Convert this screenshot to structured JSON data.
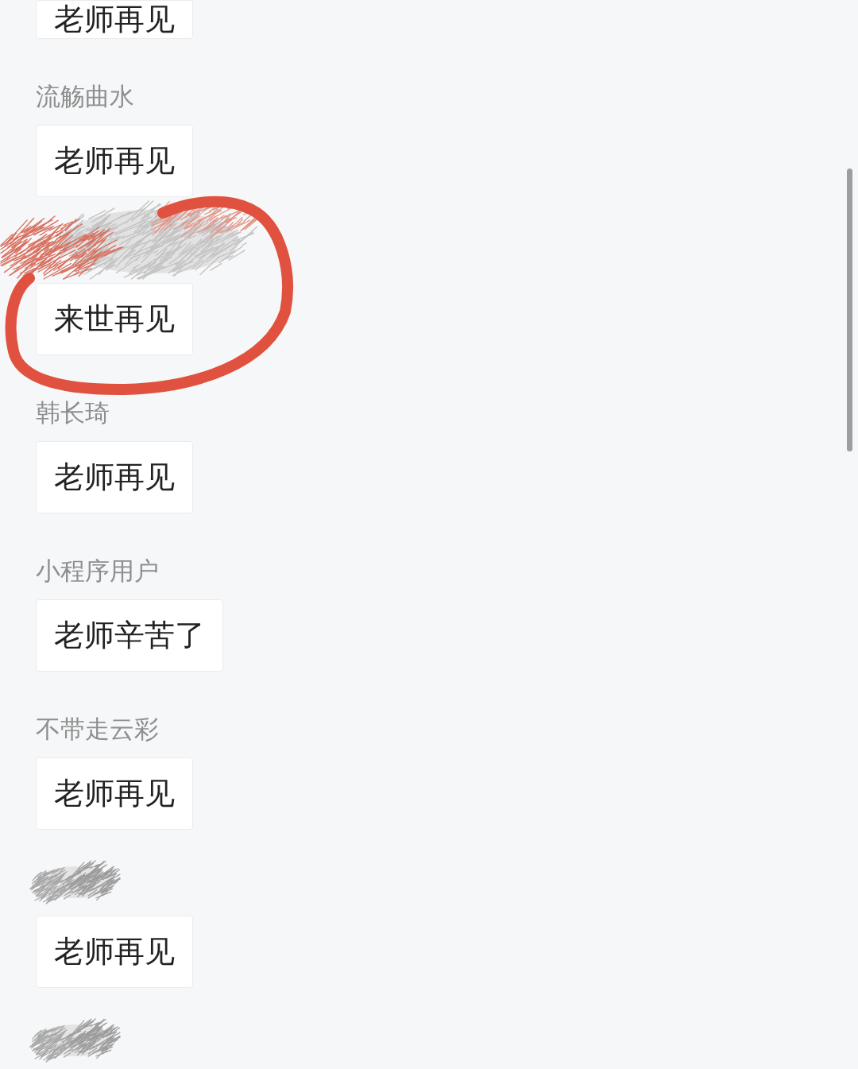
{
  "messages": [
    {
      "text": "老师再见",
      "redacted": false,
      "circled": false
    },
    {
      "sender": "流觞曲水",
      "text": "老师再见",
      "redacted": false,
      "circled": false
    },
    {
      "text": "来世再见",
      "redacted": true,
      "circled": true
    },
    {
      "sender": "韩长琦",
      "text": "老师再见",
      "redacted": false,
      "circled": false
    },
    {
      "sender": "小程序用户",
      "text": "老师辛苦了",
      "redacted": false,
      "circled": false
    },
    {
      "sender": "不带走云彩",
      "text": "老师再见",
      "redacted": false,
      "circled": false
    },
    {
      "text": "老师再见",
      "redacted": true,
      "circled": false
    },
    {
      "redacted": true,
      "circled": false
    }
  ]
}
